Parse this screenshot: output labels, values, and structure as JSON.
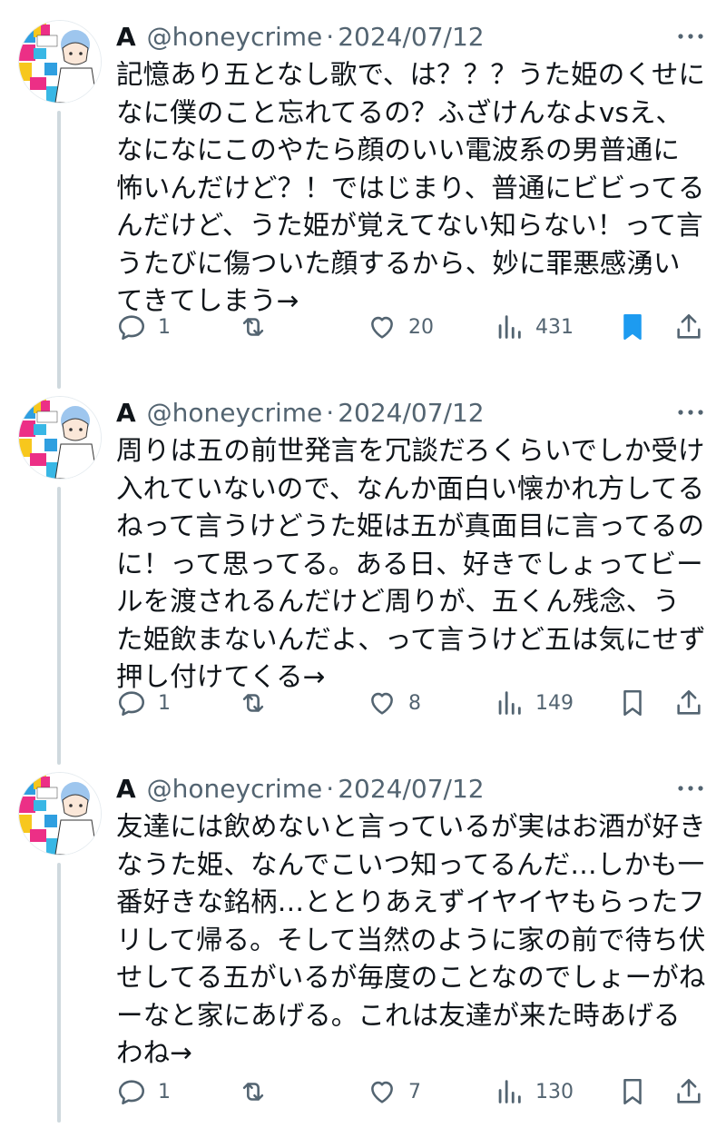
{
  "tweets": [
    {
      "name": "A",
      "handle": "@honeycrime",
      "separator": "·",
      "date": "2024/07/12",
      "text": "記憶あり五となし歌で、は？？？うた姫のくせになに僕のこと忘れてるの？ふざけんなよvsえ、なになにこのやたら顔のいい電波系の男普通に怖いんだけど？！ではじまり、普通にビビってるんだけど、うた姫が覚えてない知らない！って言うたびに傷ついた顔するから、妙に罪悪感湧いてきてしまう→",
      "replies": "1",
      "reposts": "",
      "likes": "20",
      "views": "431",
      "bookmarked": true
    },
    {
      "name": "A",
      "handle": "@honeycrime",
      "separator": "·",
      "date": "2024/07/12",
      "text": "周りは五の前世発言を冗談だろくらいでしか受け入れていないので、なんか面白い懐かれ方してるねって言うけどうた姫は五が真面目に言ってるのに！って思ってる。ある日、好きでしょってビールを渡されるんだけど周りが、五くん残念、うた姫飲まないんだよ、って言うけど五は気にせず押し付けてくる→",
      "replies": "1",
      "reposts": "",
      "likes": "8",
      "views": "149",
      "bookmarked": false
    },
    {
      "name": "A",
      "handle": "@honeycrime",
      "separator": "·",
      "date": "2024/07/12",
      "text": "友達には飲めないと言っているが実はお酒が好きなうた姫、なんでこいつ知ってるんだ…しかも一番好きな銘柄…ととりあえずイヤイヤもらったフリして帰る。そして当然のように家の前で待ち伏せしてる五がいるが毎度のことなのでしょーがねーなと家にあげる。これは友達が来た時あげるわね→",
      "replies": "1",
      "reposts": "",
      "likes": "7",
      "views": "130",
      "bookmarked": false
    }
  ],
  "icons": [
    "more-icon",
    "reply-icon",
    "repost-icon",
    "like-icon",
    "views-icon",
    "bookmark-icon",
    "share-icon"
  ],
  "colors": {
    "text": "#0f1419",
    "muted": "#536471",
    "accent": "#1d9bf0",
    "thread_line": "#cfd9de"
  }
}
